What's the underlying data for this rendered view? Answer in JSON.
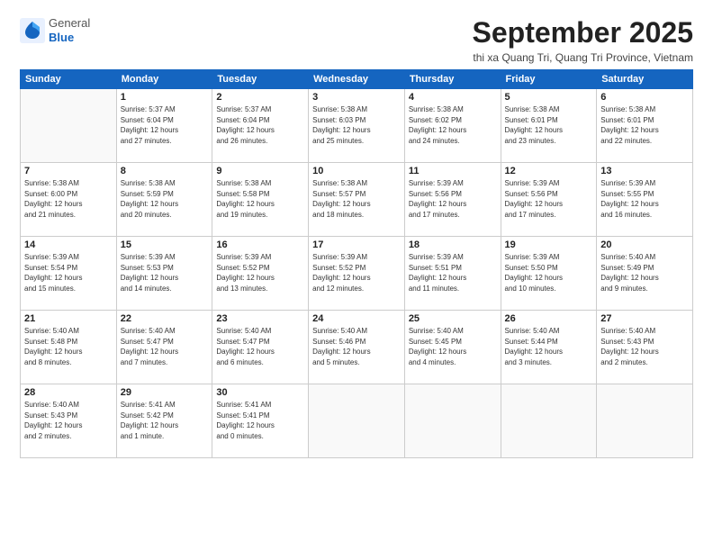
{
  "logo": {
    "general": "General",
    "blue": "Blue"
  },
  "title": "September 2025",
  "location": "thi xa Quang Tri, Quang Tri Province, Vietnam",
  "days_of_week": [
    "Sunday",
    "Monday",
    "Tuesday",
    "Wednesday",
    "Thursday",
    "Friday",
    "Saturday"
  ],
  "weeks": [
    [
      {
        "day": "",
        "info": ""
      },
      {
        "day": "1",
        "info": "Sunrise: 5:37 AM\nSunset: 6:04 PM\nDaylight: 12 hours\nand 27 minutes."
      },
      {
        "day": "2",
        "info": "Sunrise: 5:37 AM\nSunset: 6:04 PM\nDaylight: 12 hours\nand 26 minutes."
      },
      {
        "day": "3",
        "info": "Sunrise: 5:38 AM\nSunset: 6:03 PM\nDaylight: 12 hours\nand 25 minutes."
      },
      {
        "day": "4",
        "info": "Sunrise: 5:38 AM\nSunset: 6:02 PM\nDaylight: 12 hours\nand 24 minutes."
      },
      {
        "day": "5",
        "info": "Sunrise: 5:38 AM\nSunset: 6:01 PM\nDaylight: 12 hours\nand 23 minutes."
      },
      {
        "day": "6",
        "info": "Sunrise: 5:38 AM\nSunset: 6:01 PM\nDaylight: 12 hours\nand 22 minutes."
      }
    ],
    [
      {
        "day": "7",
        "info": "Sunrise: 5:38 AM\nSunset: 6:00 PM\nDaylight: 12 hours\nand 21 minutes."
      },
      {
        "day": "8",
        "info": "Sunrise: 5:38 AM\nSunset: 5:59 PM\nDaylight: 12 hours\nand 20 minutes."
      },
      {
        "day": "9",
        "info": "Sunrise: 5:38 AM\nSunset: 5:58 PM\nDaylight: 12 hours\nand 19 minutes."
      },
      {
        "day": "10",
        "info": "Sunrise: 5:38 AM\nSunset: 5:57 PM\nDaylight: 12 hours\nand 18 minutes."
      },
      {
        "day": "11",
        "info": "Sunrise: 5:39 AM\nSunset: 5:56 PM\nDaylight: 12 hours\nand 17 minutes."
      },
      {
        "day": "12",
        "info": "Sunrise: 5:39 AM\nSunset: 5:56 PM\nDaylight: 12 hours\nand 17 minutes."
      },
      {
        "day": "13",
        "info": "Sunrise: 5:39 AM\nSunset: 5:55 PM\nDaylight: 12 hours\nand 16 minutes."
      }
    ],
    [
      {
        "day": "14",
        "info": "Sunrise: 5:39 AM\nSunset: 5:54 PM\nDaylight: 12 hours\nand 15 minutes."
      },
      {
        "day": "15",
        "info": "Sunrise: 5:39 AM\nSunset: 5:53 PM\nDaylight: 12 hours\nand 14 minutes."
      },
      {
        "day": "16",
        "info": "Sunrise: 5:39 AM\nSunset: 5:52 PM\nDaylight: 12 hours\nand 13 minutes."
      },
      {
        "day": "17",
        "info": "Sunrise: 5:39 AM\nSunset: 5:52 PM\nDaylight: 12 hours\nand 12 minutes."
      },
      {
        "day": "18",
        "info": "Sunrise: 5:39 AM\nSunset: 5:51 PM\nDaylight: 12 hours\nand 11 minutes."
      },
      {
        "day": "19",
        "info": "Sunrise: 5:39 AM\nSunset: 5:50 PM\nDaylight: 12 hours\nand 10 minutes."
      },
      {
        "day": "20",
        "info": "Sunrise: 5:40 AM\nSunset: 5:49 PM\nDaylight: 12 hours\nand 9 minutes."
      }
    ],
    [
      {
        "day": "21",
        "info": "Sunrise: 5:40 AM\nSunset: 5:48 PM\nDaylight: 12 hours\nand 8 minutes."
      },
      {
        "day": "22",
        "info": "Sunrise: 5:40 AM\nSunset: 5:47 PM\nDaylight: 12 hours\nand 7 minutes."
      },
      {
        "day": "23",
        "info": "Sunrise: 5:40 AM\nSunset: 5:47 PM\nDaylight: 12 hours\nand 6 minutes."
      },
      {
        "day": "24",
        "info": "Sunrise: 5:40 AM\nSunset: 5:46 PM\nDaylight: 12 hours\nand 5 minutes."
      },
      {
        "day": "25",
        "info": "Sunrise: 5:40 AM\nSunset: 5:45 PM\nDaylight: 12 hours\nand 4 minutes."
      },
      {
        "day": "26",
        "info": "Sunrise: 5:40 AM\nSunset: 5:44 PM\nDaylight: 12 hours\nand 3 minutes."
      },
      {
        "day": "27",
        "info": "Sunrise: 5:40 AM\nSunset: 5:43 PM\nDaylight: 12 hours\nand 2 minutes."
      }
    ],
    [
      {
        "day": "28",
        "info": "Sunrise: 5:40 AM\nSunset: 5:43 PM\nDaylight: 12 hours\nand 2 minutes."
      },
      {
        "day": "29",
        "info": "Sunrise: 5:41 AM\nSunset: 5:42 PM\nDaylight: 12 hours\nand 1 minute."
      },
      {
        "day": "30",
        "info": "Sunrise: 5:41 AM\nSunset: 5:41 PM\nDaylight: 12 hours\nand 0 minutes."
      },
      {
        "day": "",
        "info": ""
      },
      {
        "day": "",
        "info": ""
      },
      {
        "day": "",
        "info": ""
      },
      {
        "day": "",
        "info": ""
      }
    ]
  ]
}
